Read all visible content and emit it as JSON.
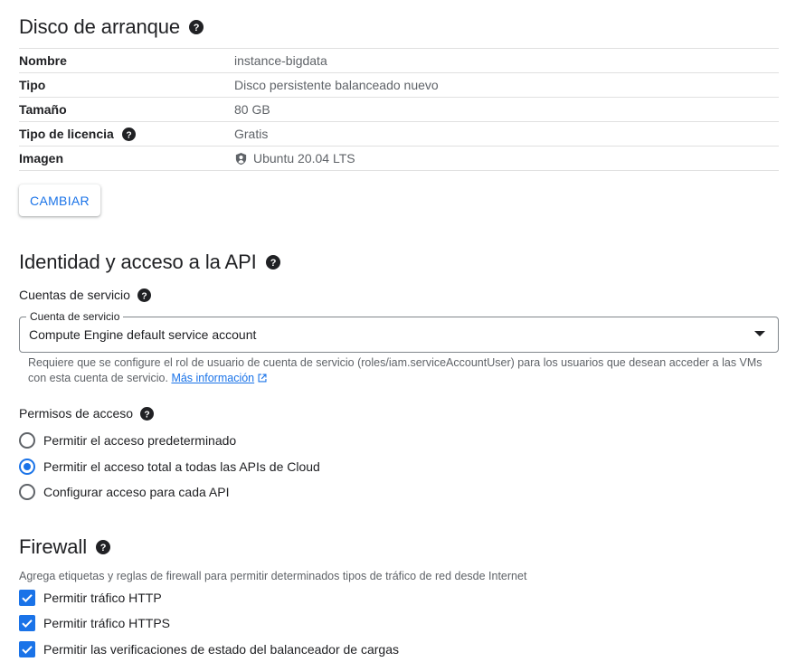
{
  "boot_disk": {
    "title": "Disco de arranque",
    "rows": [
      {
        "key": "Nombre",
        "value": "instance-bigdata"
      },
      {
        "key": "Tipo",
        "value": "Disco persistente balanceado nuevo"
      },
      {
        "key": "Tamaño",
        "value": "80 GB"
      },
      {
        "key": "Tipo de licencia",
        "value": "Gratis"
      },
      {
        "key": "Imagen",
        "value": "Ubuntu 20.04 LTS"
      }
    ],
    "change_label": "CAMBIAR"
  },
  "identity": {
    "title": "Identidad y acceso a la API",
    "service_accounts_label": "Cuentas de servicio",
    "select": {
      "legend": "Cuenta de servicio",
      "value": "Compute Engine default service account"
    },
    "hint_text": "Requiere que se configure el rol de usuario de cuenta de servicio (roles/iam.serviceAccountUser) para los usuarios que desean acceder a las VMs con esta cuenta de servicio. ",
    "hint_link": "Más información",
    "access_label": "Permisos de acceso",
    "access_options": [
      {
        "label": "Permitir el acceso predeterminado",
        "checked": false
      },
      {
        "label": "Permitir el acceso total a todas las APIs de Cloud",
        "checked": true
      },
      {
        "label": "Configurar acceso para cada API",
        "checked": false
      }
    ]
  },
  "firewall": {
    "title": "Firewall",
    "description": "Agrega etiquetas y reglas de firewall para permitir determinados tipos de tráfico de red desde Internet",
    "options": [
      {
        "label": "Permitir tráfico HTTP",
        "checked": true
      },
      {
        "label": "Permitir tráfico HTTPS",
        "checked": true
      },
      {
        "label": "Permitir las verificaciones de estado del balanceador de cargas",
        "checked": true
      }
    ]
  },
  "colors": {
    "accent": "#1a73e8",
    "text": "#202124",
    "secondary_text": "#5f6368",
    "divider": "#e0e0e0"
  }
}
